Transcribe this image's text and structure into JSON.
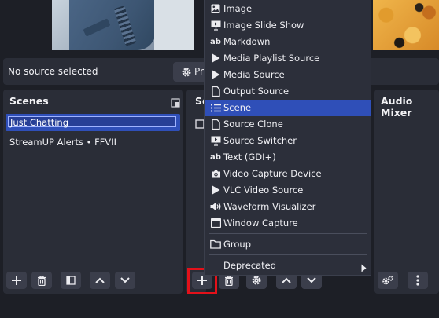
{
  "source_bar": {
    "status": "No source selected",
    "properties_label": "Pr"
  },
  "scenes": {
    "header": "Scenes",
    "items": [
      {
        "label": "Just Chatting",
        "selected": true,
        "editing": true
      },
      {
        "label": "StreamUP Alerts • FFVII"
      }
    ]
  },
  "sources": {
    "header": "So"
  },
  "audio_mixer": {
    "header": "Audio Mixer"
  },
  "add_source_menu": {
    "items": [
      {
        "label": "Image",
        "icon": "image-icon"
      },
      {
        "label": "Image Slide Show",
        "icon": "slideshow-icon"
      },
      {
        "label": "Markdown",
        "icon": "ab-text-icon"
      },
      {
        "label": "Media Playlist Source",
        "icon": "play-icon"
      },
      {
        "label": "Media Source",
        "icon": "play-icon"
      },
      {
        "label": "Output Source",
        "icon": "file-icon"
      },
      {
        "label": "Scene",
        "icon": "list-icon",
        "selected": true
      },
      {
        "label": "Source Clone",
        "icon": "file-icon"
      },
      {
        "label": "Source Switcher",
        "icon": "slideshow-icon"
      },
      {
        "label": "Text (GDI+)",
        "icon": "ab-text-icon"
      },
      {
        "label": "Video Capture Device",
        "icon": "camera-icon"
      },
      {
        "label": "VLC Video Source",
        "icon": "play-icon"
      },
      {
        "label": "Waveform Visualizer",
        "icon": "speaker-icon"
      },
      {
        "label": "Window Capture",
        "icon": "window-icon"
      }
    ],
    "group_label": "Group",
    "deprecated_label": "Deprecated"
  },
  "colors": {
    "accent": "#2f4fb8",
    "panel": "#2a2d37",
    "background": "#1d1f26",
    "highlight": "#e3111a"
  }
}
